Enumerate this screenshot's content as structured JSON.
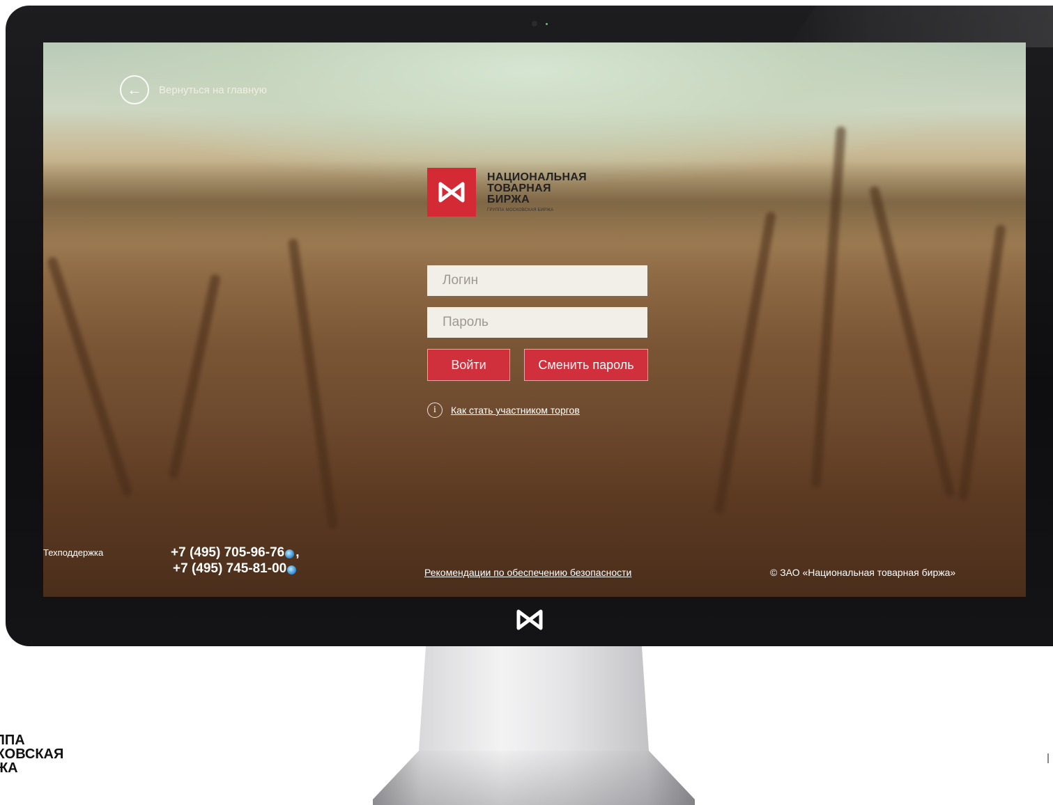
{
  "screen": {
    "back_link": {
      "label": "Вернуться на главную",
      "icon": "arrow-left-icon"
    },
    "logo": {
      "lines": [
        "НАЦИОНАЛЬНАЯ",
        "ТОВАРНАЯ",
        "БИРЖА"
      ],
      "subline": "ГРУППА МОСКОВСКАЯ БИРЖА",
      "color": "#d42a36"
    },
    "login_form": {
      "login_placeholder": "Логин",
      "password_placeholder": "Пароль",
      "login_button": "Войти",
      "change_password_button": "Сменить пароль",
      "button_color": "#d0303b"
    },
    "info_link": {
      "icon": "info-icon",
      "label": "Как стать участником торгов"
    },
    "footer": {
      "support_label": "Техподдержка",
      "phones": [
        "+7 (495) 705-96-76",
        "+7 (495) 745-81-00"
      ],
      "phone_separator": ",",
      "security_link": "Рекомендации по обеспечению безопасности",
      "copyright": "© ЗАО «Национальная товарная биржа»"
    }
  },
  "corner_brand": {
    "lines": [
      "УППА",
      "СКОВСКАЯ",
      "РЖА"
    ]
  }
}
